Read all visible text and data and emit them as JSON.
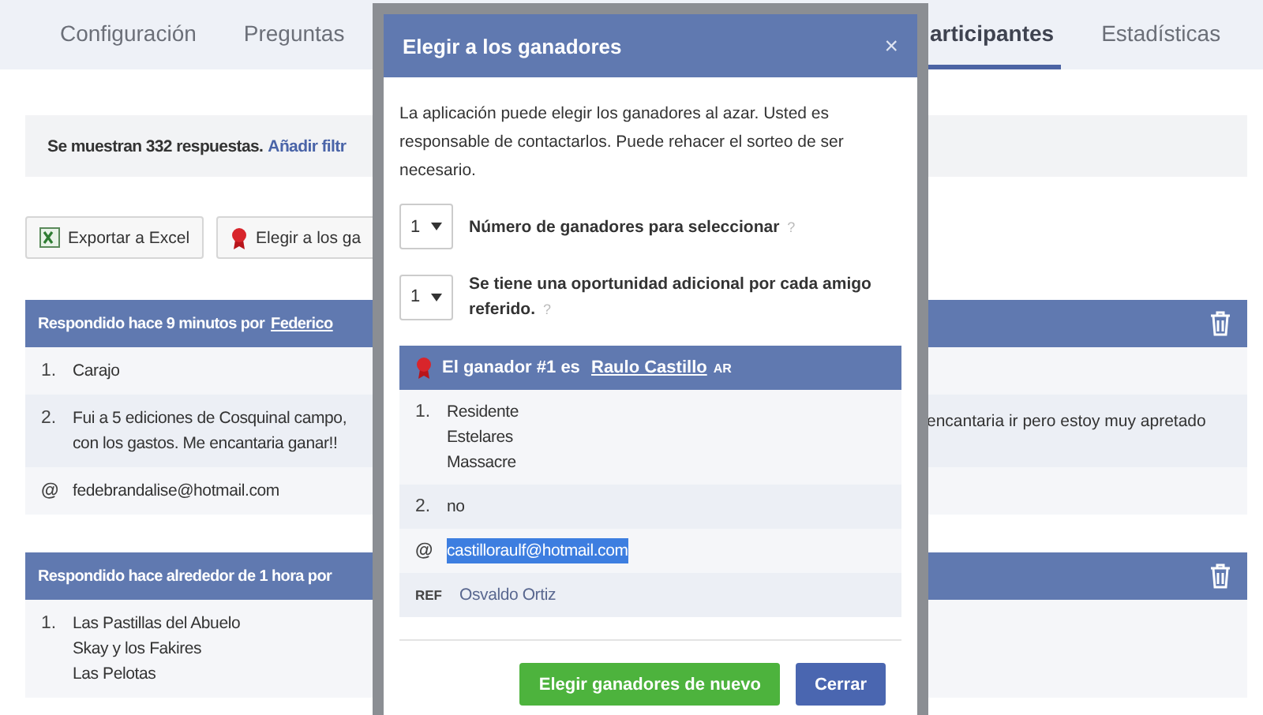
{
  "tabs": [
    {
      "label": "Configuración",
      "selected": false
    },
    {
      "label": "Preguntas",
      "selected": false
    },
    {
      "label": "articipantes",
      "selected": true
    },
    {
      "label": "Estadísticas",
      "selected": false
    }
  ],
  "info": {
    "text": "Se muestran 332 respuestas.",
    "link": "Añadir filtr"
  },
  "actions": [
    {
      "kind": "excel",
      "label": "Exportar a Excel"
    },
    {
      "kind": "ribbon",
      "label": "Elegir a los ga"
    }
  ],
  "responses": [
    {
      "header": "Respondido hace 9 minutos por",
      "author": "Federico",
      "rows": [
        {
          "kind": "numbered",
          "marker": "1.",
          "lines": [
            "Carajo"
          ]
        },
        {
          "kind": "numbered",
          "marker": "2.",
          "lines": [
            "Fui a 5 ediciones de Cosquinal campo,",
            "con los gastos. Me encantaria ganar!!"
          ],
          "right": "encantaria ir pero estoy muy apretado"
        },
        {
          "kind": "email",
          "marker": "@",
          "lines": [
            "fedebrandalise@hotmail.com"
          ]
        }
      ]
    },
    {
      "header": "Respondido hace alrededor de 1 hora por",
      "rows": [
        {
          "kind": "numbered",
          "marker": "1.",
          "lines": [
            "Las Pastillas del Abuelo",
            "Skay y los Fakires",
            "Las Pelotas"
          ]
        }
      ]
    }
  ],
  "dialog": {
    "title": "Elegir a los ganadores",
    "close": "×",
    "description": "La aplicación puede elegir los ganadores al azar. Usted es responsable de contactarlos. Puede rehacer el sorteo de ser necesario.",
    "fields": [
      {
        "value": "1",
        "label": "Número de ganadores para seleccionar",
        "help": "?"
      },
      {
        "value": "1",
        "label": "Se tiene una oportunidad adicional por cada amigo referido.",
        "help": "?"
      }
    ],
    "winner": {
      "prefix": "El ganador #1 es",
      "name": "Raulo Castillo",
      "country": "AR",
      "rows": [
        {
          "kind": "numbered",
          "marker": "1.",
          "lines": [
            "Residente",
            "Estelares",
            "Massacre"
          ],
          "highlighted": false
        },
        {
          "kind": "numbered",
          "marker": "2.",
          "lines": [
            "no"
          ],
          "highlighted": false
        },
        {
          "kind": "email",
          "marker": "@",
          "lines": [
            "castilloraulf@hotmail.com"
          ],
          "highlighted": true
        },
        {
          "kind": "ref",
          "marker": "REF",
          "lines": [
            "Osvaldo Ortiz"
          ],
          "highlighted": false
        }
      ]
    },
    "buttons": [
      {
        "kind": "primary",
        "label": "Elegir ganadores de nuevo"
      },
      {
        "kind": "secondary",
        "label": "Cerrar"
      }
    ]
  }
}
